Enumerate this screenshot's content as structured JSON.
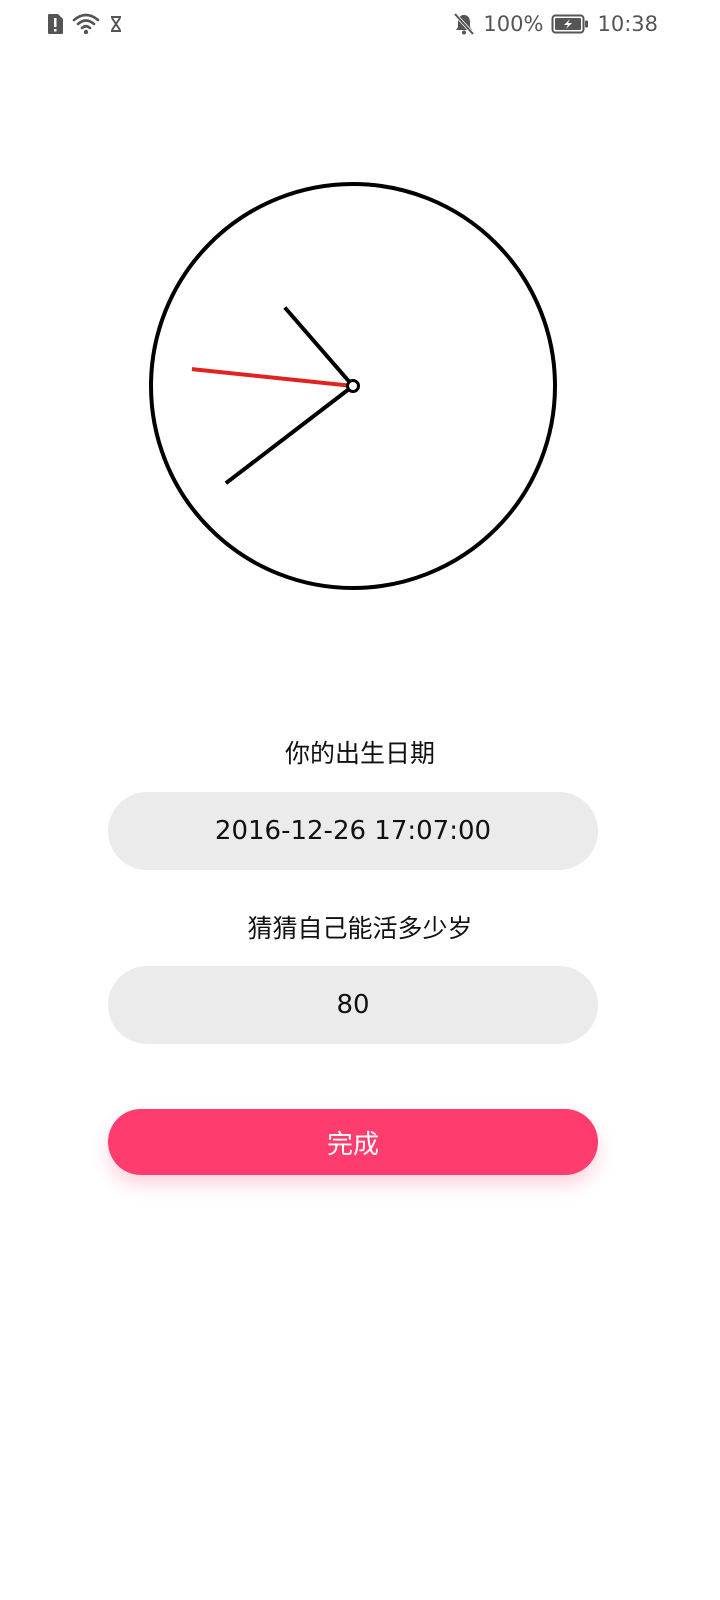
{
  "status_bar": {
    "battery_percent": "100%",
    "time": "10:38",
    "icons": [
      "sim-alert-icon",
      "wifi-icon",
      "signal-off-icon",
      "bell-off-icon",
      "battery-charging-icon"
    ]
  },
  "clock": {
    "hour": 10,
    "minute": 38,
    "second": 46,
    "colors": {
      "face": "#000000",
      "hands": "#000000",
      "second_hand": "#e0231c"
    }
  },
  "form": {
    "birth_label": "你的出生日期",
    "birth_value": "2016-12-26 17:07:00",
    "lifespan_label": "猜猜自己能活多少岁",
    "lifespan_value": "80",
    "done_label": "完成"
  },
  "colors": {
    "accent": "#ff3c6e",
    "field_bg": "#ebebeb"
  }
}
